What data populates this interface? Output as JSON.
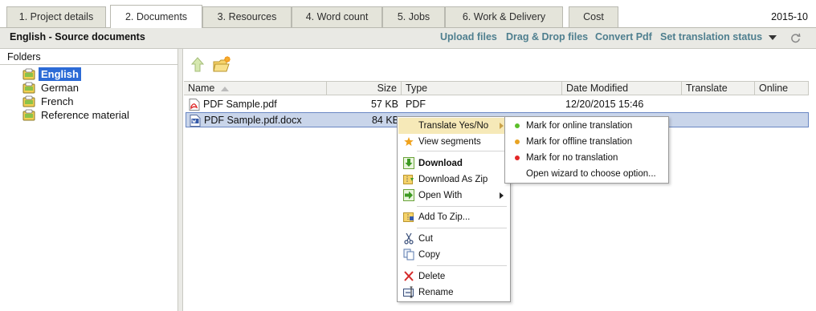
{
  "tabs": [
    {
      "label": "1. Project details",
      "active": false
    },
    {
      "label": "2. Documents",
      "active": true
    },
    {
      "label": "3. Resources",
      "active": false
    },
    {
      "label": "4. Word count",
      "active": false
    },
    {
      "label": "5. Jobs",
      "active": false
    },
    {
      "label": "6. Work & Delivery",
      "active": false
    },
    {
      "label": "Cost",
      "active": false
    }
  ],
  "period": "2015-10",
  "header": {
    "title": "English - Source documents",
    "links": [
      "Upload files",
      "Drag & Drop files",
      "Convert Pdf",
      "Set translation status"
    ],
    "dropdown_icon": "chevron-down-icon",
    "refresh_icon": "refresh-icon"
  },
  "folders": {
    "title": "Folders",
    "items": [
      {
        "label": "English",
        "selected": true
      },
      {
        "label": "German",
        "selected": false
      },
      {
        "label": "French",
        "selected": false
      },
      {
        "label": "Reference material",
        "selected": false
      }
    ]
  },
  "toolbar": {
    "up_icon": "folder-up-icon",
    "new_icon": "new-folder-icon"
  },
  "columns": [
    "Name",
    "Size",
    "Type",
    "Date Modified",
    "Translate",
    "Online"
  ],
  "files": [
    {
      "name": "PDF Sample.pdf",
      "size": "57 KB",
      "type": "PDF",
      "modified": "12/20/2015 15:46",
      "translate": "",
      "online": "",
      "icon": "pdf-file-icon",
      "selected": false
    },
    {
      "name": "PDF Sample.pdf.docx",
      "size": "84 KB",
      "type": "",
      "modified": "",
      "translate": "",
      "online": "",
      "icon": "word-file-icon",
      "selected": true
    }
  ],
  "context_menu": {
    "items": [
      {
        "label": "Translate Yes/No",
        "icon": "none",
        "has_submenu": true,
        "hover": true
      },
      {
        "label": "View segments",
        "icon": "star-icon"
      },
      {
        "label": "Download",
        "icon": "download-icon",
        "bold": true
      },
      {
        "label": "Download As Zip",
        "icon": "zip-download-icon"
      },
      {
        "label": "Open With",
        "icon": "open-with-icon",
        "has_submenu": true
      },
      {
        "label": "Add To Zip...",
        "icon": "add-to-zip-icon"
      },
      {
        "label": "Cut",
        "icon": "scissors-icon"
      },
      {
        "label": "Copy",
        "icon": "copy-icon"
      },
      {
        "label": "Delete",
        "icon": "delete-x-icon"
      },
      {
        "label": "Rename",
        "icon": "rename-icon"
      }
    ]
  },
  "submenu": {
    "items": [
      {
        "label": "Mark for online translation",
        "dot_color": "#5cbf2a"
      },
      {
        "label": "Mark for offline translation",
        "dot_color": "#e8a323"
      },
      {
        "label": "Mark for no translation",
        "dot_color": "#e32626"
      },
      {
        "label": "Open wizard to choose option...",
        "dot_color": ""
      }
    ]
  },
  "colors": {
    "tab_bg": "#e4e4da",
    "header_bg": "#e9e9e4",
    "link": "#4f7f8f",
    "selection": "#2d6bd6",
    "row_selected": "#c9d5ea",
    "menu_hover": "#f6e9b8"
  }
}
